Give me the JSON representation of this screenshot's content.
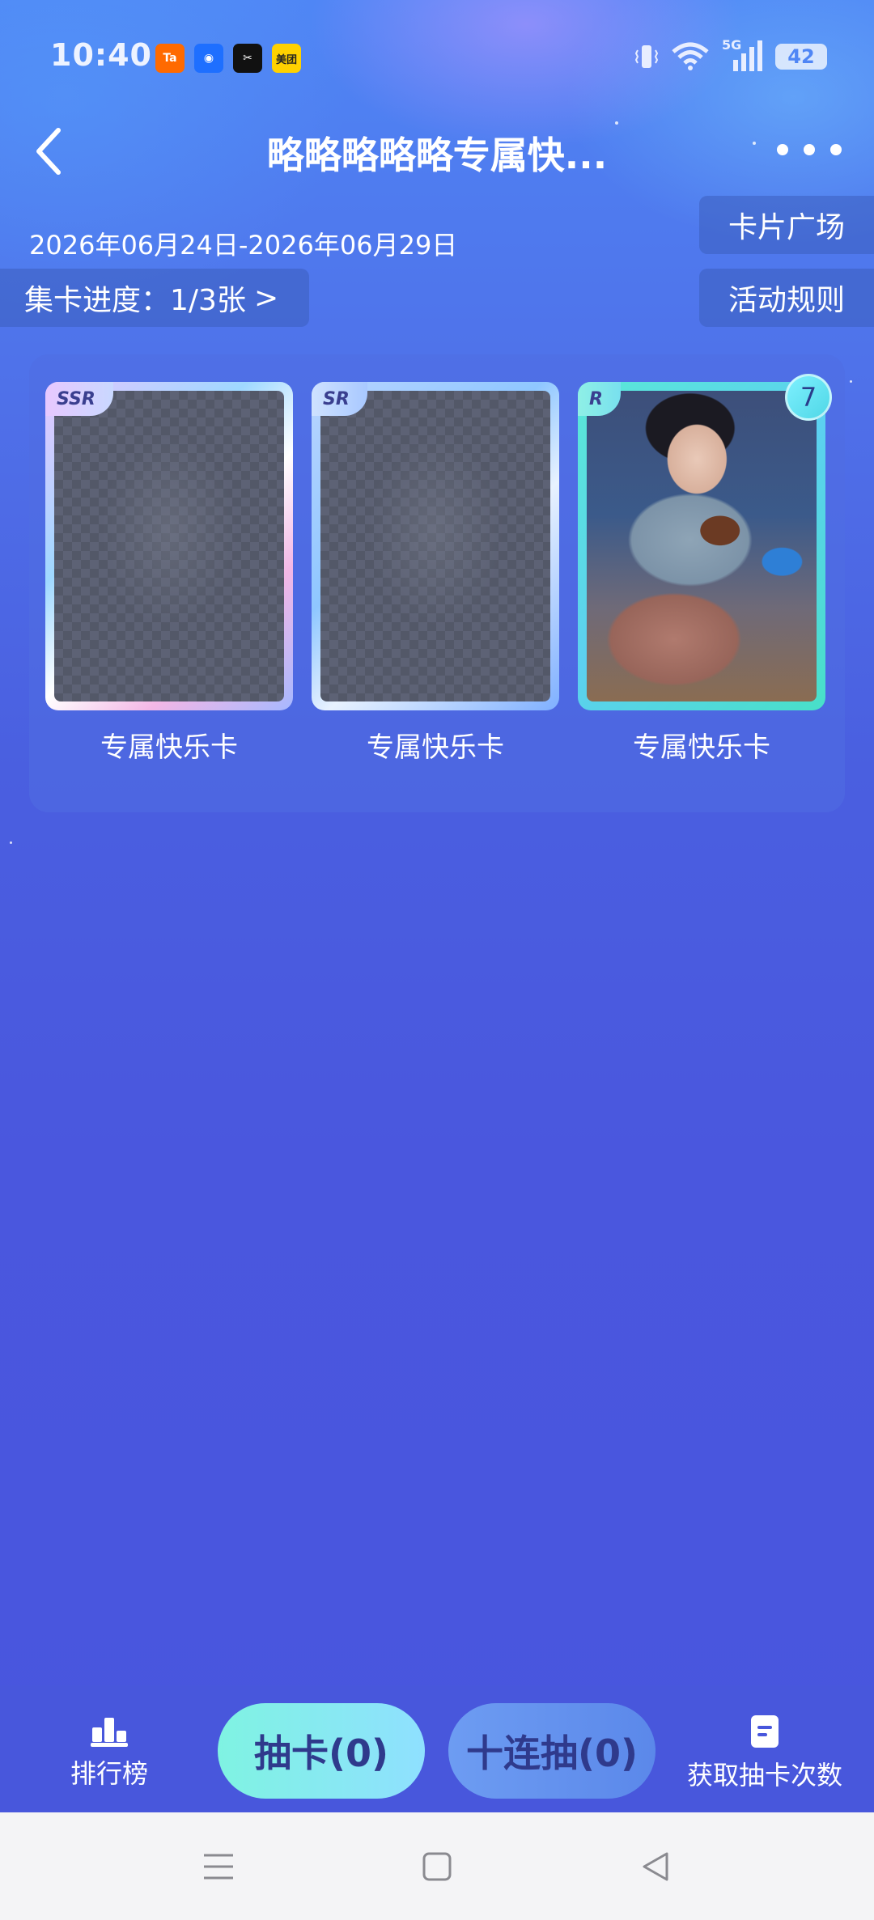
{
  "status_bar": {
    "time": "10:40",
    "app_icons": [
      {
        "name": "taobao-icon",
        "text": "Ta",
        "color": "#ff6a00"
      },
      {
        "name": "youku-icon",
        "text": "◉",
        "color": "#1e6fff"
      },
      {
        "name": "capcut-icon",
        "text": "✂",
        "color": "#111111"
      },
      {
        "name": "meituan-icon",
        "text": "美团",
        "color": "#ffd100"
      }
    ],
    "network": "5G",
    "battery": "42"
  },
  "header": {
    "title": "略略略略略专属快..."
  },
  "event": {
    "date_range": "2026年06月24日-2026年06月29日",
    "progress_label": "集卡进度：1/3张",
    "progress_chevron": ">",
    "card_square_label": "卡片广场",
    "rules_label": "活动规则"
  },
  "cards": [
    {
      "rarity": "SSR",
      "label": "专属快乐卡",
      "owned": false
    },
    {
      "rarity": "SR",
      "label": "专属快乐卡",
      "owned": false
    },
    {
      "rarity": "R",
      "label": "专属快乐卡",
      "owned": true,
      "count": "7"
    }
  ],
  "bottom_bar": {
    "ranking_label": "排行榜",
    "draw_one_label": "抽卡(0)",
    "draw_ten_label": "十连抽(0)",
    "get_chances_label": "获取抽卡次数"
  },
  "colors": {
    "accent_cyan": "#7ff3e2",
    "button_text": "#2f3a8c",
    "background": "#4a57de"
  }
}
